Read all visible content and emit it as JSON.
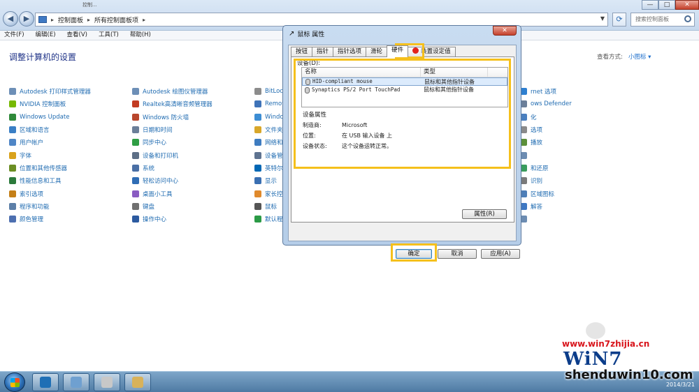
{
  "window": {
    "tab_peek": "控制...",
    "breadcrumb": [
      "控制面板",
      "所有控制面板项"
    ],
    "search_placeholder": "搜索控制面板",
    "minimize": "—",
    "maximize": "□",
    "close": "✕"
  },
  "menu": [
    "文件(F)",
    "编辑(E)",
    "查看(V)",
    "工具(T)",
    "帮助(H)"
  ],
  "page": {
    "title": "调整计算机的设置",
    "view_mode_label": "查看方式:",
    "view_mode_value": "小图标 ▾"
  },
  "control_panel": {
    "col1": [
      {
        "label": "Autodesk 打印样式管理器",
        "color": "#6d8fb7"
      },
      {
        "label": "NVIDIA 控制面板",
        "color": "#76b900"
      },
      {
        "label": "Windows Update",
        "color": "#2f8a3a"
      },
      {
        "label": "区域和语言",
        "color": "#3a7fc5"
      },
      {
        "label": "用户帐户",
        "color": "#4f86c6"
      },
      {
        "label": "字体",
        "color": "#d9a21b"
      },
      {
        "label": "位置和其他传感器",
        "color": "#6b8e23"
      },
      {
        "label": "性能信息和工具",
        "color": "#2b7a3b"
      },
      {
        "label": "索引选项",
        "color": "#c47f17"
      },
      {
        "label": "程序和功能",
        "color": "#5c7fa8"
      },
      {
        "label": "颜色管理",
        "color": "#4d6fb0"
      }
    ],
    "col2": [
      {
        "label": "Autodesk 绘图仪管理器",
        "color": "#6d8fb7"
      },
      {
        "label": "Realtek高清晰音频管理器",
        "color": "#c23b22"
      },
      {
        "label": "Windows 防火墙",
        "color": "#b8462c"
      },
      {
        "label": "日期和时间",
        "color": "#6b7f99"
      },
      {
        "label": "同步中心",
        "color": "#2f9e44"
      },
      {
        "label": "设备和打印机",
        "color": "#5d6f86"
      },
      {
        "label": "系统",
        "color": "#4a6fa5"
      },
      {
        "label": "轻松访问中心",
        "color": "#2f6db5"
      },
      {
        "label": "桌面小工具",
        "color": "#8a5cc2"
      },
      {
        "label": "键盘",
        "color": "#707070"
      },
      {
        "label": "操作中心",
        "color": "#2c5aa0"
      }
    ],
    "col3": [
      {
        "label": "BitLocker",
        "color": "#8c8c8c"
      },
      {
        "label": "RemoteApp",
        "color": "#3f73b8"
      },
      {
        "label": "Windows",
        "color": "#3c8dd4"
      },
      {
        "label": "文件夹选项",
        "color": "#d8a72a"
      },
      {
        "label": "网络和共享",
        "color": "#3e7cc0"
      },
      {
        "label": "设备管理器",
        "color": "#5e7390"
      },
      {
        "label": "英特尔",
        "color": "#0067b4"
      },
      {
        "label": "显示",
        "color": "#3a6fb2"
      },
      {
        "label": "家长控制",
        "color": "#e08a2c"
      },
      {
        "label": "鼠标",
        "color": "#555555"
      },
      {
        "label": "默认程序",
        "color": "#2b9a46"
      }
    ],
    "col4": [
      {
        "label": "rnet 选项",
        "color": "#2d7fd0"
      },
      {
        "label": "ows Defender",
        "color": "#6b7f99"
      },
      {
        "label": "化",
        "color": "#4a7fbf"
      },
      {
        "label": "选项",
        "color": "#8a8a8a"
      },
      {
        "label": "播放",
        "color": "#5c8f3a"
      },
      {
        "label": "",
        "color": "#6c8cb2"
      },
      {
        "label": "和还原",
        "color": "#3a9c5c"
      },
      {
        "label": "识别",
        "color": "#7a7a7a"
      },
      {
        "label": "区域图标",
        "color": "#4f7fb8"
      },
      {
        "label": "解答",
        "color": "#3f78c2"
      },
      {
        "label": "",
        "color": "#6c8cb2"
      }
    ]
  },
  "dialog": {
    "title": "鼠标 属性",
    "close": "✕",
    "tabs": [
      "按钮",
      "指针",
      "指针选项",
      "滑轮",
      "硬件",
      "装置设定值"
    ],
    "active_tab": "硬件",
    "devices_label": "设备(D):",
    "columns": {
      "name": "名称",
      "type": "类型"
    },
    "devices": [
      {
        "name": "HID-compliant mouse",
        "type": "鼠标和其他指针设备"
      },
      {
        "name": "Synaptics PS/2 Port TouchPad",
        "type": "鼠标和其他指针设备"
      }
    ],
    "props_title": "设备属性",
    "props": [
      {
        "key": "制造商:",
        "value": "Microsoft"
      },
      {
        "key": "位置:",
        "value": "在 USB 输入设备 上"
      },
      {
        "key": "设备状态:",
        "value": "这个设备运转正常。"
      }
    ],
    "properties_button": "属性(R)",
    "ok_button": "确定",
    "cancel_button": "取消",
    "apply_button": "应用(A)",
    "highlight_color": "#f5c01c"
  },
  "taskbar": {
    "date": "2014/3/21",
    "pinned": [
      {
        "name": "app-a",
        "color": "#1f6fb5"
      },
      {
        "name": "control-panel",
        "color": "#6fa0d0"
      },
      {
        "name": "mouse",
        "color": "#c8c8c8"
      },
      {
        "name": "paint",
        "color": "#d8b25a"
      }
    ]
  },
  "watermark": {
    "url": "www.win7zhijia.cn",
    "logo": "WiN7",
    "site": "shenduwin10.com"
  }
}
